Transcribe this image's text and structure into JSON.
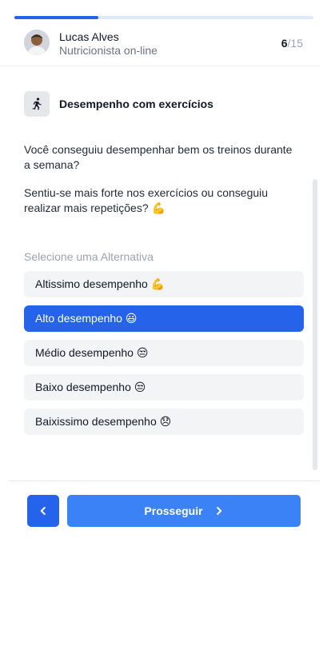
{
  "progress": {
    "fraction": 0.28
  },
  "header": {
    "name": "Lucas Alves",
    "role": "Nutricionista on-line",
    "step_current": "6",
    "step_total": "/15"
  },
  "section": {
    "icon": "running-person-icon",
    "title": "Desempenho com exercícios"
  },
  "questions": [
    "Você conseguiu desempenhar bem os treinos durante a semana?",
    "Sentiu-se mais forte nos exercícios ou conseguiu realizar mais repetições? 💪"
  ],
  "options_label": "Selecione uma Alternativa",
  "options": [
    {
      "label": "Altissimo desempenho 💪",
      "selected": false
    },
    {
      "label": "Alto desempenho 😃",
      "selected": true
    },
    {
      "label": "Médio desempenho 😒",
      "selected": false
    },
    {
      "label": "Baixo desempenho 😒",
      "selected": false
    },
    {
      "label": "Baixissimo desempenho 😞",
      "selected": false
    }
  ],
  "footer": {
    "back_icon": "chevron-left-icon",
    "next_label": "Prosseguir",
    "next_icon": "chevron-right-icon"
  },
  "colors": {
    "accent": "#2563eb",
    "accent_light": "#3b82f6",
    "progress_track": "#dbeafe",
    "option_bg": "#f3f4f6"
  }
}
